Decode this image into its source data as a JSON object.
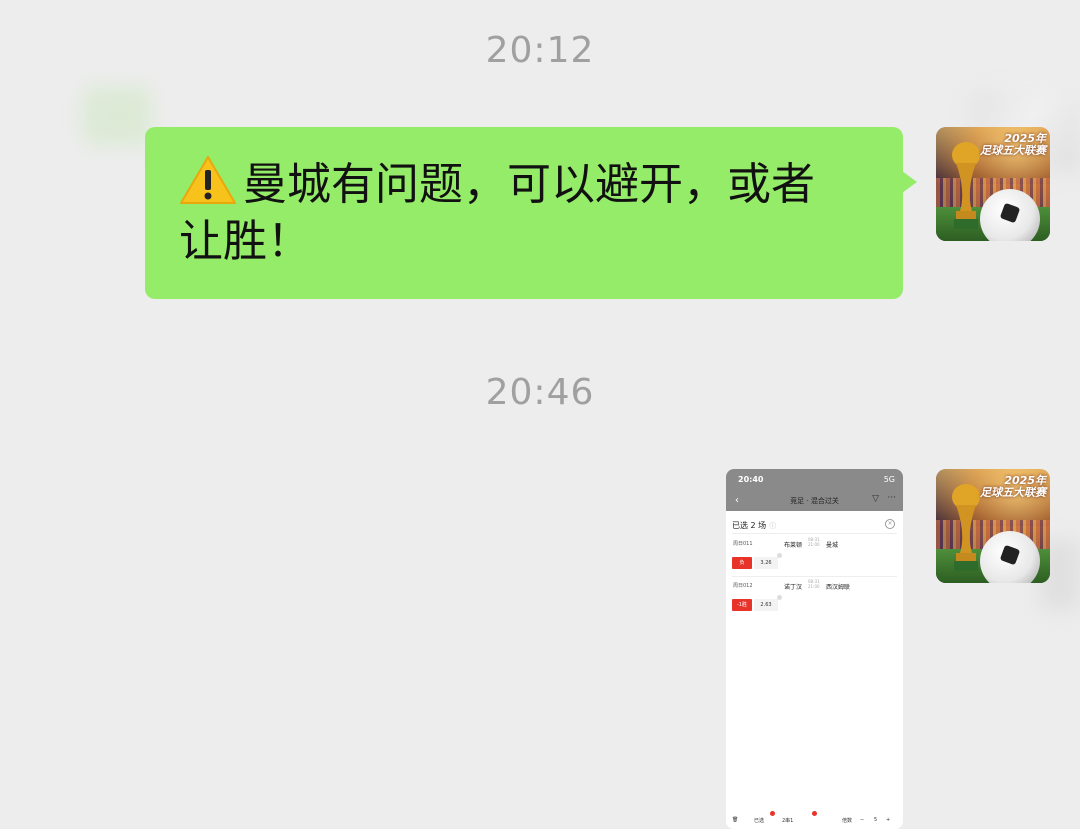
{
  "chat": {
    "timestamps": [
      "20:12",
      "20:46"
    ],
    "message": {
      "icon": "warning-icon",
      "line1": "曼城有问题，可以避开，或者",
      "line2": "让胜！",
      "bubble_color": "#95ec69"
    },
    "avatar": {
      "icon": "world-cup-trophy-avatar",
      "caption_line1": "2025年",
      "caption_line2": "足球五大联赛"
    }
  },
  "screenshot": {
    "status_time": "20:40",
    "status_network": "5G",
    "nav_title": "竞足 · 混合过关",
    "selected_title": "已选 2 场",
    "matches": [
      {
        "code": "周日011",
        "home": "布莱顿",
        "away": "曼城",
        "kick_date": "08-31",
        "kick_time": "21:00",
        "pick": "负",
        "odds": "3.26"
      },
      {
        "code": "周日012",
        "home": "诺丁汉",
        "away": "西汉姆联",
        "kick_date": "08-31",
        "kick_time": "21:00",
        "pick": "-1胜",
        "odds": "2.63"
      }
    ],
    "footer": {
      "selected": "已选",
      "pass_type": "2串1",
      "multiple_label": "倍数",
      "multiple_value": "5"
    },
    "accent": "#e8332a"
  }
}
